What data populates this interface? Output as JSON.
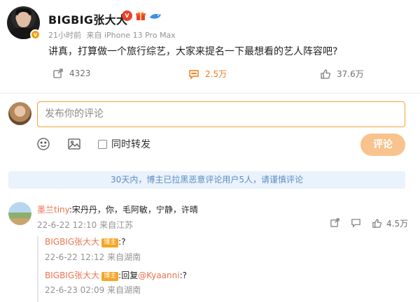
{
  "post": {
    "username": "BIGBIG张大大",
    "level_badge": "V",
    "verified_badge": "v",
    "time": "21小时前",
    "source": "来自 iPhone 13 Pro Max",
    "text": "讲真，打算做一个旅行综艺，大家来提名一下最想看的艺人阵容吧?",
    "reposts": "4323",
    "comments": "2.5万",
    "likes": "37.6万"
  },
  "composer": {
    "placeholder": "发布你的评论",
    "repost_label": "同时转发",
    "submit_label": "评论"
  },
  "notice": "30天内，博主已拉黑恶意评论用户5人，请谨慎评论",
  "comment": {
    "user": "墨兰tiny",
    "text": ":宋丹丹，你，毛阿敏，宁静，许晴",
    "date": "22-6-22 12:10",
    "location": "来自江苏",
    "likes": "4.5万",
    "replies": [
      {
        "user": "BIGBIG张大大",
        "badge": "博主",
        "text": ":?",
        "at": "",
        "date": "22-6-22 12:12",
        "location": "来自湖南"
      },
      {
        "user": "BIGBIG张大大",
        "badge": "博主",
        "prefix": ":回复",
        "at": "@Kyaanni",
        "text": ":?",
        "date": "22-6-23 02:09",
        "location": "来自湖南"
      }
    ]
  },
  "colors": {
    "accent": "#f07a1a",
    "link_orange": "#eb7350",
    "notice_bg": "#eaf2fb",
    "notice_text": "#5b8dc7"
  }
}
